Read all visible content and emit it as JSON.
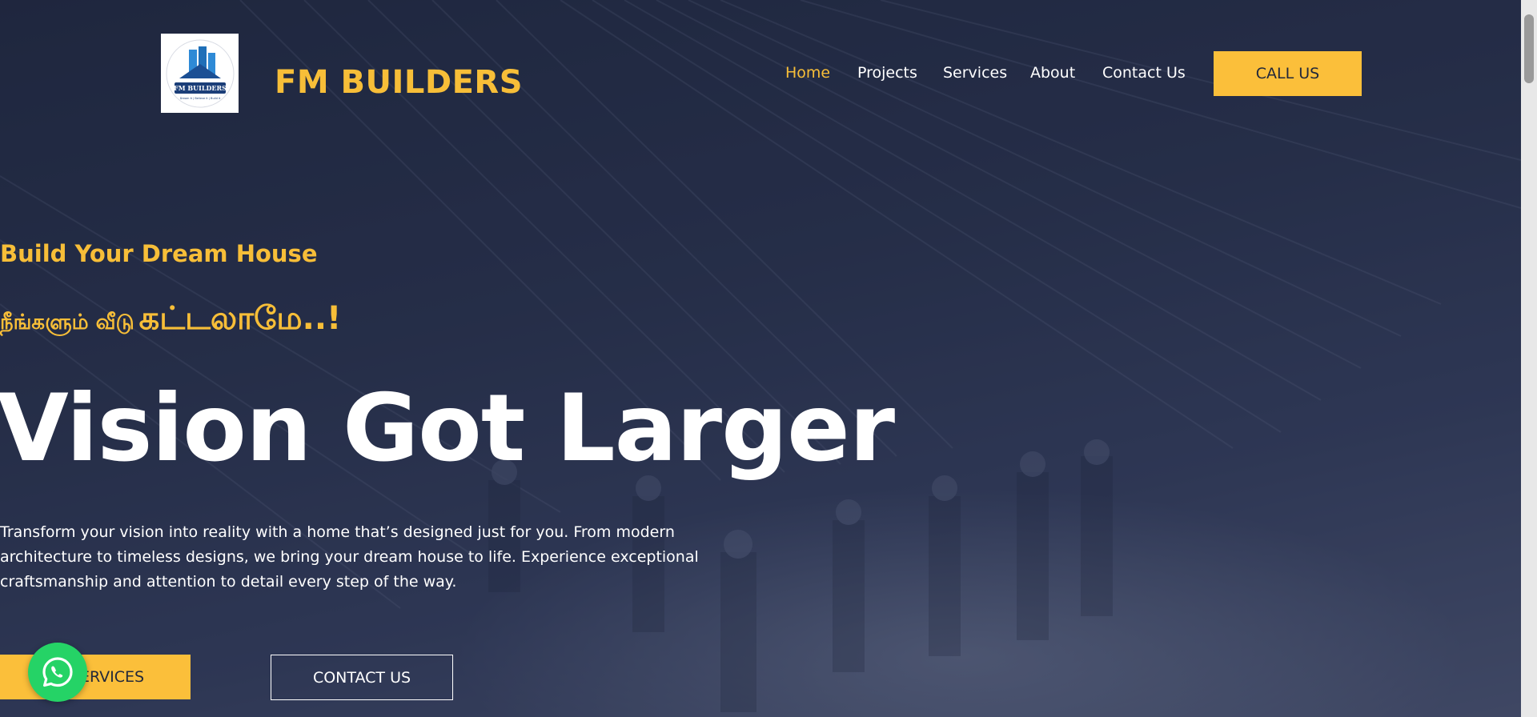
{
  "brand": {
    "name": "FM BUILDERS",
    "logo_text": "FM BUILDERS",
    "logo_tagline": "Dream it | Believe it | Build it"
  },
  "nav": {
    "items": [
      {
        "label": "Home",
        "active": true
      },
      {
        "label": "Projects",
        "active": false
      },
      {
        "label": "Services",
        "active": false
      },
      {
        "label": "About",
        "active": false
      },
      {
        "label": "Contact Us",
        "active": false
      }
    ],
    "cta_label": "CALL US"
  },
  "hero": {
    "eyebrow": "Build Your Dream House",
    "tamil_part1": "நீங்களும் வீடு",
    "tamil_part2": "கட்டலாமே..!",
    "headline": "Vision Got Larger",
    "description": "Transform your vision into reality with a home that’s designed just for you. From modern architecture to timeless designs, we bring your dream house to life. Experience exceptional craftsmanship and attention to detail every step of the way.",
    "primary_button": "SERVICES",
    "secondary_button": "CONTACT US"
  },
  "colors": {
    "accent": "#f7be38",
    "button": "#fbbf3a",
    "whatsapp": "#25d366"
  },
  "icons": {
    "chat": "whatsapp-icon",
    "logo": "building-logo-icon"
  }
}
